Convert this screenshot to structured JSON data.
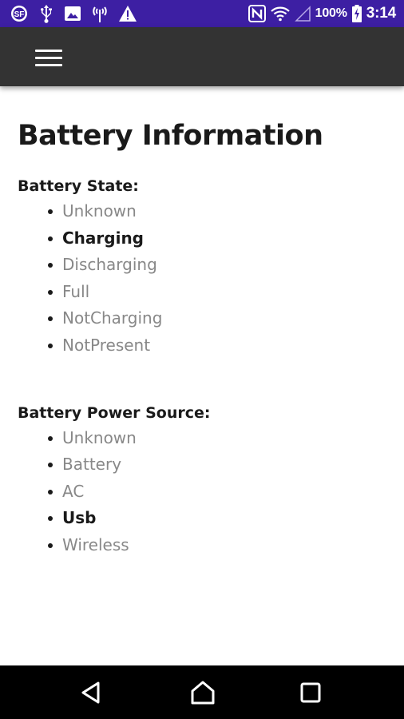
{
  "status_bar": {
    "background": "#3d1fa3",
    "left_icons": [
      "sf-app-icon",
      "usb-icon",
      "image-icon",
      "signal-tower-icon",
      "warning-icon"
    ],
    "right_icons": [
      "nfc-icon",
      "wifi-icon",
      "cellular-signal-icon",
      "battery-charging-icon"
    ],
    "battery_percent": "100%",
    "time": "3:14"
  },
  "app_bar": {
    "background": "#333333",
    "menu_icon": "hamburger-menu-icon"
  },
  "main": {
    "title": "Battery Information",
    "battery_state": {
      "label": "Battery State:",
      "options": [
        {
          "label": "Unknown",
          "active": false
        },
        {
          "label": "Charging",
          "active": true
        },
        {
          "label": "Discharging",
          "active": false
        },
        {
          "label": "Full",
          "active": false
        },
        {
          "label": "NotCharging",
          "active": false
        },
        {
          "label": "NotPresent",
          "active": false
        }
      ]
    },
    "power_source": {
      "label": "Battery Power Source:",
      "options": [
        {
          "label": "Unknown",
          "active": false
        },
        {
          "label": "Battery",
          "active": false
        },
        {
          "label": "AC",
          "active": false
        },
        {
          "label": "Usb",
          "active": true
        },
        {
          "label": "Wireless",
          "active": false
        }
      ]
    }
  },
  "colors": {
    "active_text": "#1a1a1a",
    "inactive_text": "#888888"
  },
  "nav_bar": {
    "icons": [
      "back-icon",
      "home-icon",
      "recents-icon"
    ]
  }
}
